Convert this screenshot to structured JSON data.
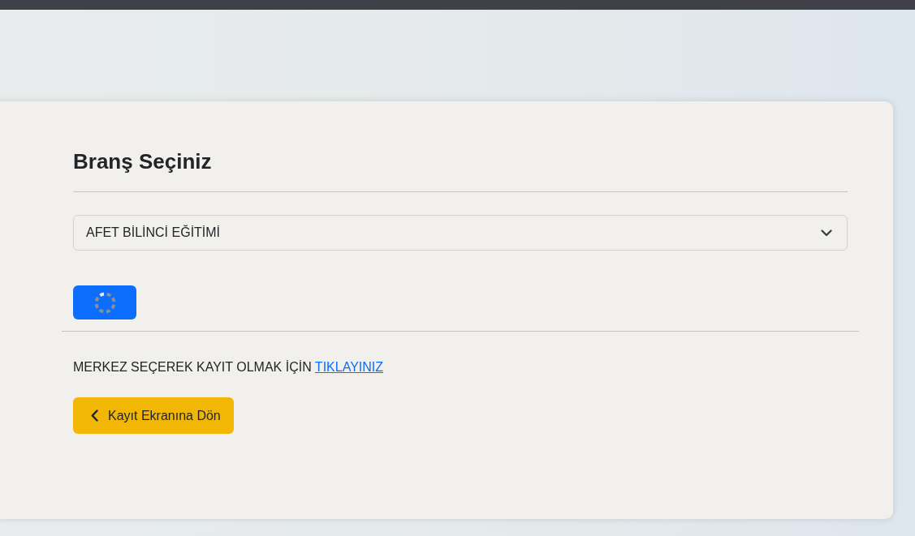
{
  "heading": "Branş Seçiniz",
  "branch_select": {
    "value": "AFET BİLİNCİ EĞİTİMİ"
  },
  "submit_button": {
    "loading": true
  },
  "register_prompt": {
    "text": "MERKEZ SEÇEREK KAYIT OLMAK İÇİN",
    "link": "TIKLAYINIZ"
  },
  "back_button": {
    "label": "Kayıt Ekranına Dön"
  }
}
